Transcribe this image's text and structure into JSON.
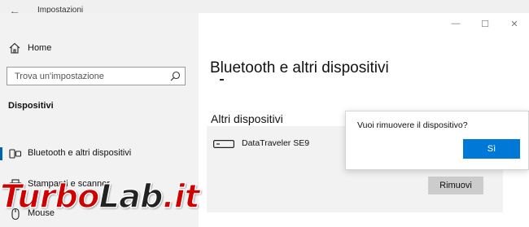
{
  "window": {
    "app_title": "Impostazioni",
    "back_glyph": "←",
    "controls": {
      "minimize": "—",
      "maximize": "☐",
      "close": "✕"
    }
  },
  "sidebar": {
    "home_label": "Home",
    "home_icon": "home-icon",
    "search": {
      "placeholder": "Trova un'impostazione",
      "icon": "search-icon"
    },
    "section_title": "Dispositivi",
    "items": [
      {
        "label": "Bluetooth e altri dispositivi",
        "icon": "bluetooth-devices-icon",
        "selected": true
      },
      {
        "label": "Stampanti e scanner",
        "icon": "printer-icon",
        "selected": false
      },
      {
        "label": "Mouse",
        "icon": "mouse-icon",
        "selected": false
      }
    ]
  },
  "main": {
    "title": "Bluetooth e altri dispositivi",
    "section_title": "Altri dispositivi",
    "device": {
      "name": "DataTraveler SE9",
      "icon": "usb-drive-icon"
    },
    "remove_label": "Rimuovi"
  },
  "dialog": {
    "message": "Vuoi rimuovere il dispositivo?",
    "confirm_label": "Sì"
  },
  "watermark": {
    "part1": "Turbo",
    "part2": "Lab",
    "part3": ".it"
  },
  "colors": {
    "accent": "#0078d7",
    "sidebar_bg": "#f2f2f2",
    "selection_bar": "#0063b1",
    "button_gray": "#cccccc",
    "watermark_red": "#d10000"
  }
}
